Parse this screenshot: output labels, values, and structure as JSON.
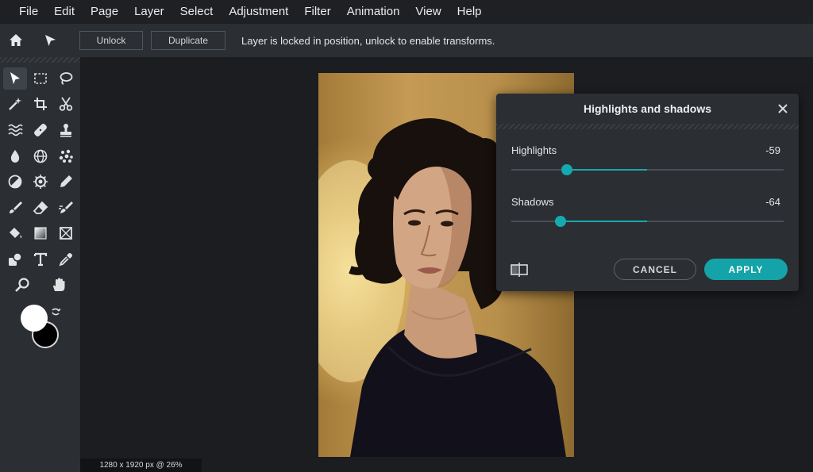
{
  "menu": [
    "File",
    "Edit",
    "Page",
    "Layer",
    "Select",
    "Adjustment",
    "Filter",
    "Animation",
    "View",
    "Help"
  ],
  "toolbar": {
    "home_icon": "home-icon",
    "pointer_icon": "pointer-icon",
    "unlock_label": "Unlock",
    "duplicate_label": "Duplicate",
    "message": "Layer is locked in position, unlock to enable transforms."
  },
  "tools": [
    "move",
    "rect-select",
    "lasso",
    "magic-wand",
    "crop",
    "cut",
    "liquify",
    "healing",
    "stamp",
    "blur",
    "sphere",
    "scatter",
    "dodge-burn",
    "sponge",
    "color-picker-pen",
    "brush",
    "eraser",
    "smudge",
    "paint-bucket",
    "gradient",
    "frame",
    "shape",
    "text",
    "eyedropper",
    "zoom",
    "hand"
  ],
  "colors": {
    "primary": "#ffffff",
    "secondary": "#000000",
    "accent": "#14a3a8"
  },
  "status": "1280 x 1920 px @ 26%",
  "dialog": {
    "title": "Highlights and shadows",
    "highlights": {
      "label": "Highlights",
      "value": "-59",
      "level": -59
    },
    "shadows": {
      "label": "Shadows",
      "value": "-64",
      "level": -64
    },
    "cancel_label": "CANCEL",
    "apply_label": "APPLY"
  }
}
